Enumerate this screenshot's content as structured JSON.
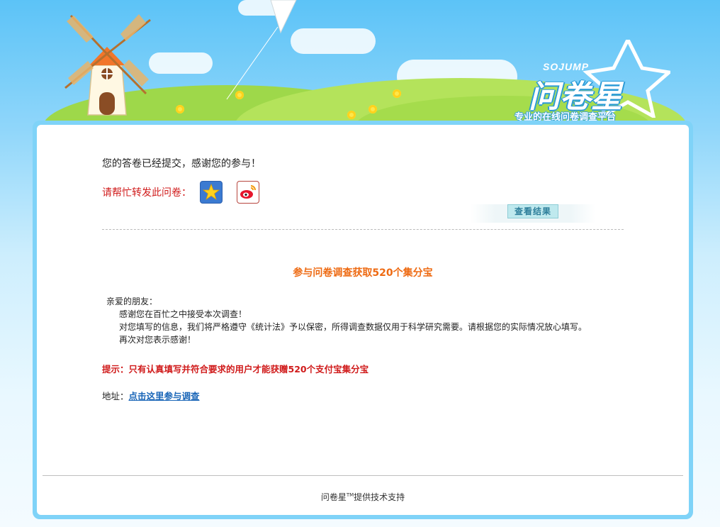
{
  "header": {
    "brand_en": "SOJUMP",
    "brand_cn": "问卷星",
    "slogan": "专业的在线问卷调查平台"
  },
  "main": {
    "thanks_text": "您的答卷已经提交，感谢您的参与！",
    "share_label": "请帮忙转发此问卷：",
    "view_result_label": "查看结果",
    "promo_title": "参与问卷调查获取520个集分宝",
    "letter": {
      "greeting": "亲爱的朋友：",
      "line1": "感谢您在百忙之中接受本次调查！",
      "line2": "对您填写的信息，我们将严格遵守《统计法》予以保密，所得调查数据仅用于科学研究需要。请根据您的实际情况放心填写。",
      "line3": "再次对您表示感谢！"
    },
    "tip": "提示：只有认真填写并符合要求的用户才能获赠520个支付宝集分宝",
    "address_label": "地址：",
    "address_link": "点击这里参与调查"
  },
  "footer": {
    "brand": "问卷星",
    "tm": "TM",
    "support": "提供技术支持"
  },
  "colors": {
    "sky": "#5cc3f7",
    "card_border": "#7fd3f8",
    "red": "#d01b1b",
    "orange": "#ee6a12",
    "link": "#1a66b8"
  },
  "icons": [
    "windmill-icon",
    "kite-icon",
    "qzone-icon",
    "weibo-icon"
  ]
}
